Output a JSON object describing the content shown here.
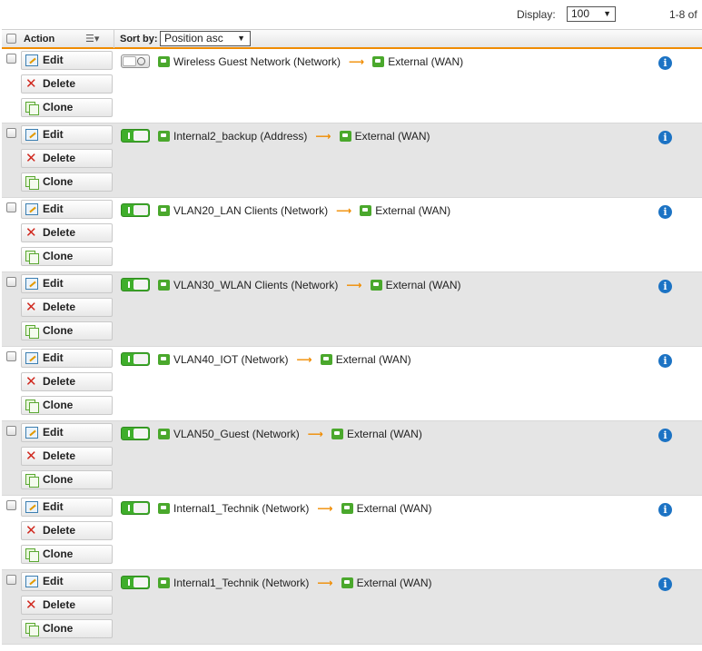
{
  "toolbar": {
    "display_label": "Display:",
    "display_value": "100",
    "pager_text": "1-8 of"
  },
  "header": {
    "action_label": "Action",
    "sortby_label": "Sort by:",
    "sort_value": "Position asc"
  },
  "buttons": {
    "edit": "Edit",
    "delete": "Delete",
    "clone": "Clone"
  },
  "rules": [
    {
      "source": "Wireless Guest Network (Network)",
      "destination": "External (WAN)",
      "enabled": false
    },
    {
      "source": "Internal2_backup (Address)",
      "destination": "External (WAN)",
      "enabled": true
    },
    {
      "source": "VLAN20_LAN Clients (Network)",
      "destination": "External (WAN)",
      "enabled": true
    },
    {
      "source": "VLAN30_WLAN Clients (Network)",
      "destination": "External (WAN)",
      "enabled": true
    },
    {
      "source": "VLAN40_IOT (Network)",
      "destination": "External (WAN)",
      "enabled": true
    },
    {
      "source": "VLAN50_Guest (Network)",
      "destination": "External (WAN)",
      "enabled": true
    },
    {
      "source": "Internal1_Technik (Network)",
      "destination": "External (WAN)",
      "enabled": true
    },
    {
      "source": "Internal1_Technik (Network)",
      "destination": "External (WAN)",
      "enabled": true
    }
  ],
  "colors": {
    "accent": "#f08c00",
    "toggle_on": "#3fae2b",
    "info": "#1c73c4",
    "delete": "#d0281e"
  }
}
